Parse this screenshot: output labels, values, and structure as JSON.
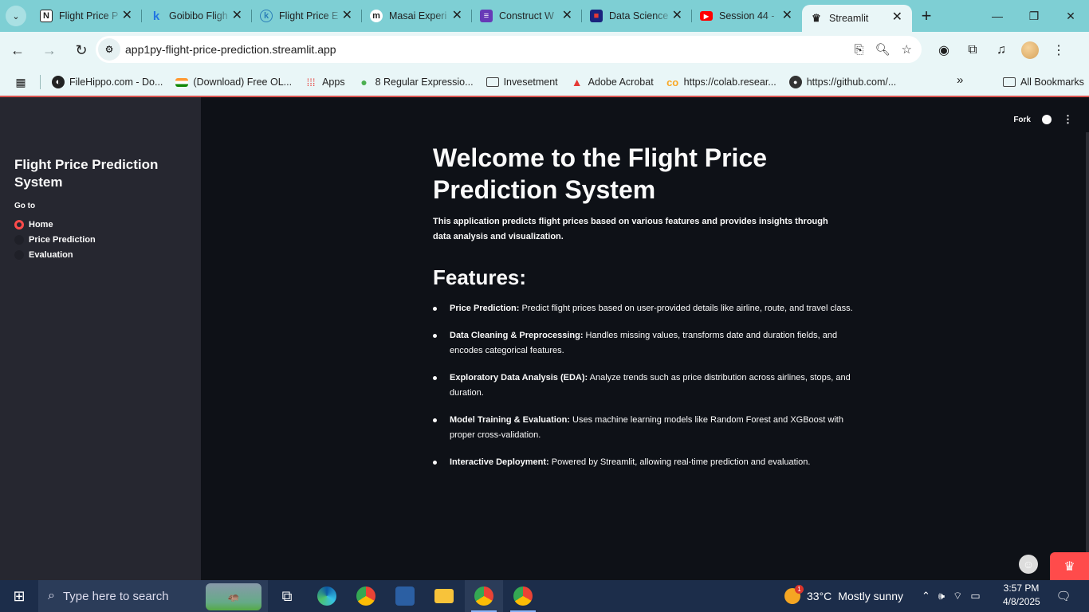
{
  "browser": {
    "tabs": [
      {
        "title": "Flight Price P",
        "favicon": "notion-icon"
      },
      {
        "title": "Goibibo Fligh",
        "favicon": "goibibo-icon"
      },
      {
        "title": "Flight Price E",
        "favicon": "kaggle-icon"
      },
      {
        "title": "Masai Experi",
        "favicon": "masai-icon"
      },
      {
        "title": "Construct W",
        "favicon": "form-icon"
      },
      {
        "title": "Data Science",
        "favicon": "datascience-icon"
      },
      {
        "title": "Session 44 -",
        "favicon": "youtube-icon"
      },
      {
        "title": "Streamlit",
        "favicon": "streamlit-icon",
        "active": true
      }
    ],
    "url": "app1py-flight-price-prediction.streamlit.app",
    "bookmarks": [
      {
        "label": "FileHippo.com - Do...",
        "icon": "filehippo-icon"
      },
      {
        "label": "(Download) Free OL...",
        "icon": "india-flag-icon"
      },
      {
        "label": "Apps",
        "icon": "apps-grid-icon"
      },
      {
        "label": "8 Regular Expressio...",
        "icon": "leaf-icon"
      },
      {
        "label": "Invesetment",
        "icon": "folder-icon"
      },
      {
        "label": "Adobe Acrobat",
        "icon": "acrobat-icon"
      },
      {
        "label": "https://colab.resear...",
        "icon": "colab-icon"
      },
      {
        "label": "https://github.com/...",
        "icon": "github-icon"
      }
    ],
    "all_bookmarks": "All Bookmarks"
  },
  "sidebar": {
    "title": "Flight Price Prediction System",
    "goto_label": "Go to",
    "options": [
      {
        "label": "Home",
        "selected": true
      },
      {
        "label": "Price Prediction",
        "selected": false
      },
      {
        "label": "Evaluation",
        "selected": false
      }
    ]
  },
  "header": {
    "fork_label": "Fork"
  },
  "main": {
    "title": "Welcome to the Flight Price Prediction System",
    "intro": "This application predicts flight prices based on various features and provides insights through data analysis and visualization.",
    "features_heading": "Features:",
    "features": [
      {
        "name": "Price Prediction:",
        "desc": " Predict flight prices based on user-provided details like airline, route, and travel class."
      },
      {
        "name": "Data Cleaning & Preprocessing:",
        "desc": " Handles missing values, transforms date and duration fields, and encodes categorical features."
      },
      {
        "name": "Exploratory Data Analysis (EDA):",
        "desc": " Analyze trends such as price distribution across airlines, stops, and duration."
      },
      {
        "name": "Model Training & Evaluation:",
        "desc": " Uses machine learning models like Random Forest and XGBoost with proper cross-validation."
      },
      {
        "name": "Interactive Deployment:",
        "desc": " Powered by Streamlit, allowing real-time prediction and evaluation."
      }
    ]
  },
  "taskbar": {
    "search_placeholder": "Type here to search",
    "weather_temp": "33°C",
    "weather_text": "Mostly sunny",
    "weather_badge": "1",
    "time": "3:57 PM",
    "date": "4/8/2025"
  },
  "colors": {
    "accent": "#ff4b4b",
    "sidebar_bg": "#262730",
    "main_bg": "#0e1117",
    "chrome": "#7ecfd4"
  }
}
